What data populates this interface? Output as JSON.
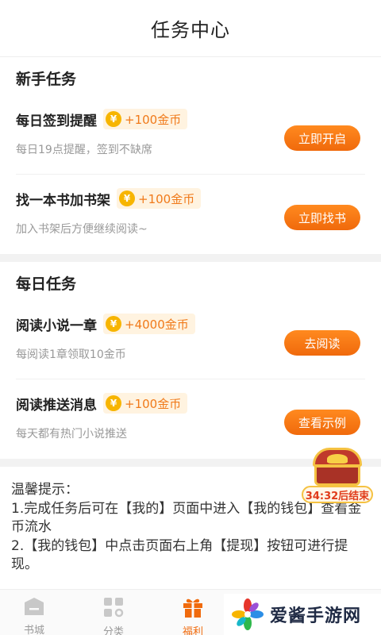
{
  "header": {
    "title": "任务中心"
  },
  "sections": [
    {
      "title": "新手任务",
      "tasks": [
        {
          "name": "每日签到提醒",
          "reward": "+100金币",
          "desc": "每日19点提醒，签到不缺席",
          "button": "立即开启"
        },
        {
          "name": "找一本书加书架",
          "reward": "+100金币",
          "desc": "加入书架后方便继续阅读~",
          "button": "立即找书"
        }
      ]
    },
    {
      "title": "每日任务",
      "tasks": [
        {
          "name": "阅读小说一章",
          "reward": "+4000金币",
          "desc": "每阅读1章领取10金币",
          "button": "去阅读"
        },
        {
          "name": "阅读推送消息",
          "reward": "+100金币",
          "desc": "每天都有热门小说推送",
          "button": "查看示例"
        }
      ]
    }
  ],
  "coin_symbol": "¥",
  "tips": {
    "title": "温馨提示：",
    "line1": "1.完成任务后可在【我的】页面中进入【我的钱包】查看金币流水",
    "line2": "2.【我的钱包】中点击页面右上角【提现】按钮可进行提现。"
  },
  "promo": {
    "label": "34:32后结束",
    "icon": "treasure-chest-icon"
  },
  "nav": [
    {
      "label": "书城",
      "icon": "bookstore-icon",
      "active": false
    },
    {
      "label": "分类",
      "icon": "category-grid-icon",
      "active": false
    },
    {
      "label": "福利",
      "icon": "gift-icon",
      "active": true
    }
  ],
  "watermark": {
    "text": "爱酱手游网",
    "icon": "pinwheel-logo-icon"
  },
  "colors": {
    "accent": "#f06a0c",
    "coin": "#f7b500",
    "reward_bg": "#fff3e0",
    "reward_text": "#f07a1a"
  }
}
